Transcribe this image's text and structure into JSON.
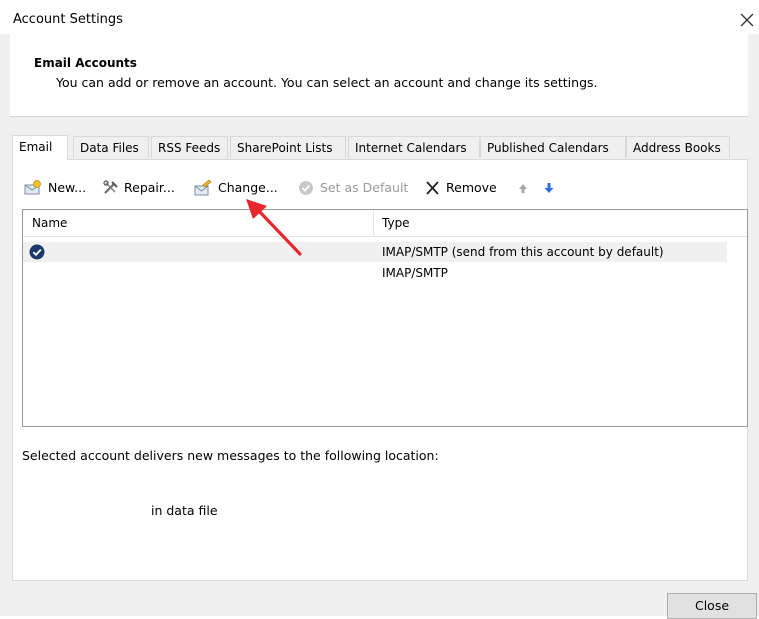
{
  "window": {
    "title": "Account Settings",
    "close_glyph": "✕"
  },
  "header": {
    "title": "Email Accounts",
    "description": "You can add or remove an account. You can select an account and change its settings."
  },
  "tabs": [
    {
      "label": "Email",
      "active": true
    },
    {
      "label": "Data Files"
    },
    {
      "label": "RSS Feeds"
    },
    {
      "label": "SharePoint Lists"
    },
    {
      "label": "Internet Calendars"
    },
    {
      "label": "Published Calendars"
    },
    {
      "label": "Address Books"
    }
  ],
  "toolbar": {
    "new_label": "New...",
    "repair_label": "Repair...",
    "change_label": "Change...",
    "set_default_label": "Set as Default",
    "remove_label": "Remove"
  },
  "list": {
    "columns": {
      "name": "Name",
      "type": "Type"
    },
    "rows": [
      {
        "name": "",
        "type": "IMAP/SMTP (send from this account by default)",
        "default": true,
        "selected": true
      },
      {
        "name": "",
        "type": "IMAP/SMTP",
        "default": false,
        "selected": false
      }
    ]
  },
  "delivery": {
    "label": "Selected account delivers new messages to the following location:",
    "location_suffix": "in data file"
  },
  "footer": {
    "close_label": "Close"
  },
  "colors": {
    "dialog_bg": "#f0f0f0",
    "arrow": "#e8262d",
    "check_badge": "#1b3a6b",
    "down_arrow": "#2f6fde"
  }
}
